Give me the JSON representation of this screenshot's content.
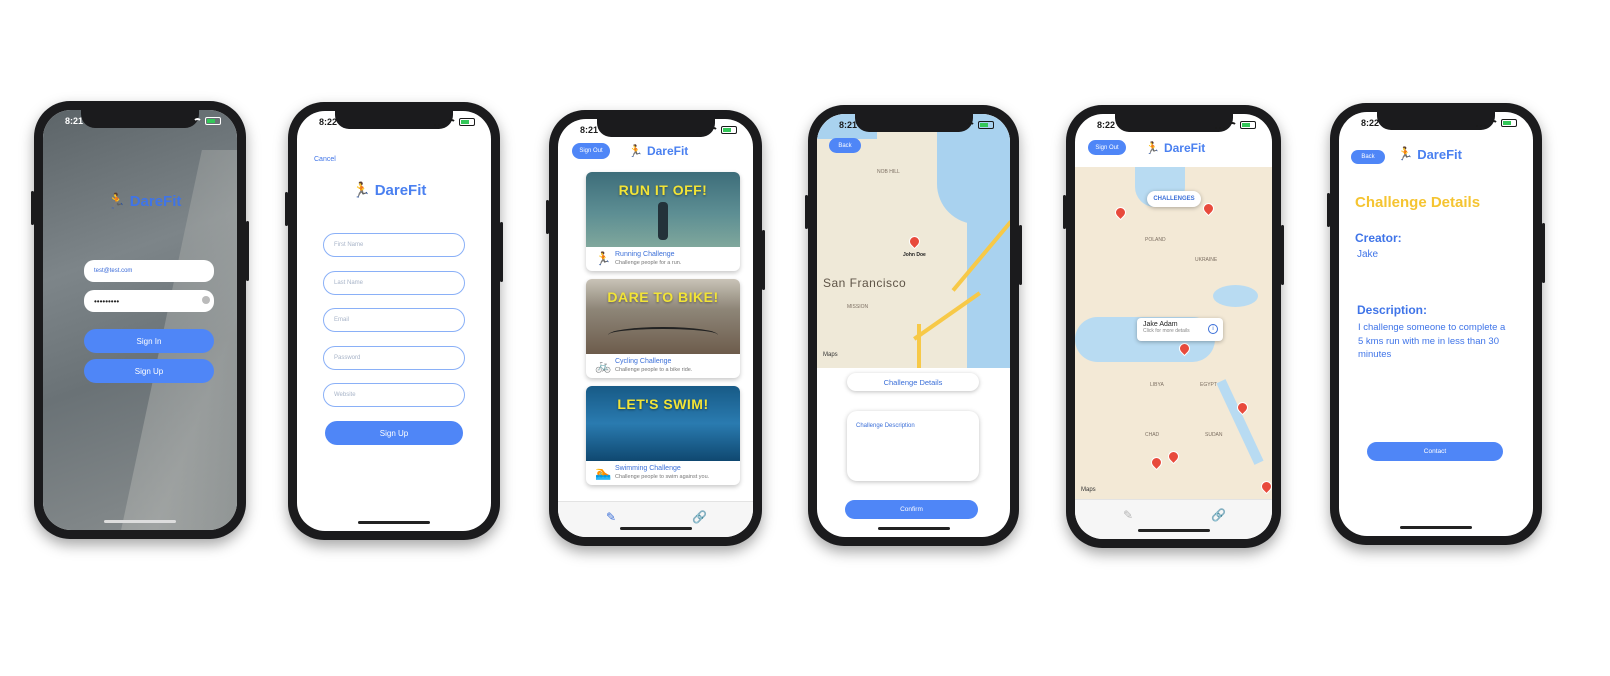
{
  "screen1": {
    "time": "8:21",
    "logo": "DareFit",
    "email_value": "test@test.com",
    "password_value": "•••••••••",
    "sign_in": "Sign In",
    "sign_up": "Sign Up"
  },
  "screen2": {
    "time": "8:22",
    "cancel": "Cancel",
    "logo": "DareFit",
    "fields": [
      "First Name",
      "Last Name",
      "Email",
      "Password",
      "Website"
    ],
    "sign_up": "Sign Up"
  },
  "screen3": {
    "time": "8:21",
    "sign_out": "Sign Out",
    "logo": "DareFit",
    "cards": [
      {
        "banner": "RUN IT OFF!",
        "name": "Running Challenge",
        "desc": "Challenge people for a run.",
        "icon": "runner-icon"
      },
      {
        "banner": "DARE TO BIKE!",
        "name": "Cycling Challenge",
        "desc": "Challenge people to a bike ride.",
        "icon": "bike-icon"
      },
      {
        "banner": "LET'S SWIM!",
        "name": "Swimming Challenge",
        "desc": "Challenge people to swim against you.",
        "icon": "swim-icon"
      }
    ]
  },
  "screen4": {
    "time": "8:21",
    "back": "Back",
    "city": "San Francisco",
    "pin_label": "John Doe",
    "maps_badge": "Maps",
    "challenge_details": "Challenge Details",
    "description_placeholder": "Challenge Description",
    "confirm": "Confirm"
  },
  "screen5": {
    "time": "8:22",
    "sign_out": "Sign Out",
    "logo": "DareFit",
    "challenges_badge": "CHALLENGES",
    "callout_name": "Jake Adam",
    "callout_sub": "Click for more details",
    "maps_badge": "Maps"
  },
  "screen6": {
    "time": "8:22",
    "back": "Back",
    "logo": "DareFit",
    "title": "Challenge Details",
    "creator_label": "Creator:",
    "creator_value": "Jake",
    "description_label": "Description:",
    "description_value": "I challenge someone to complete a 5 kms run with me in less than 30 minutes",
    "contact": "Contact"
  },
  "colors": {
    "accent": "#4f86f7",
    "title_yellow": "#f5c431",
    "banner_yellow": "#f2e437",
    "pin_red": "#e84a3c"
  }
}
